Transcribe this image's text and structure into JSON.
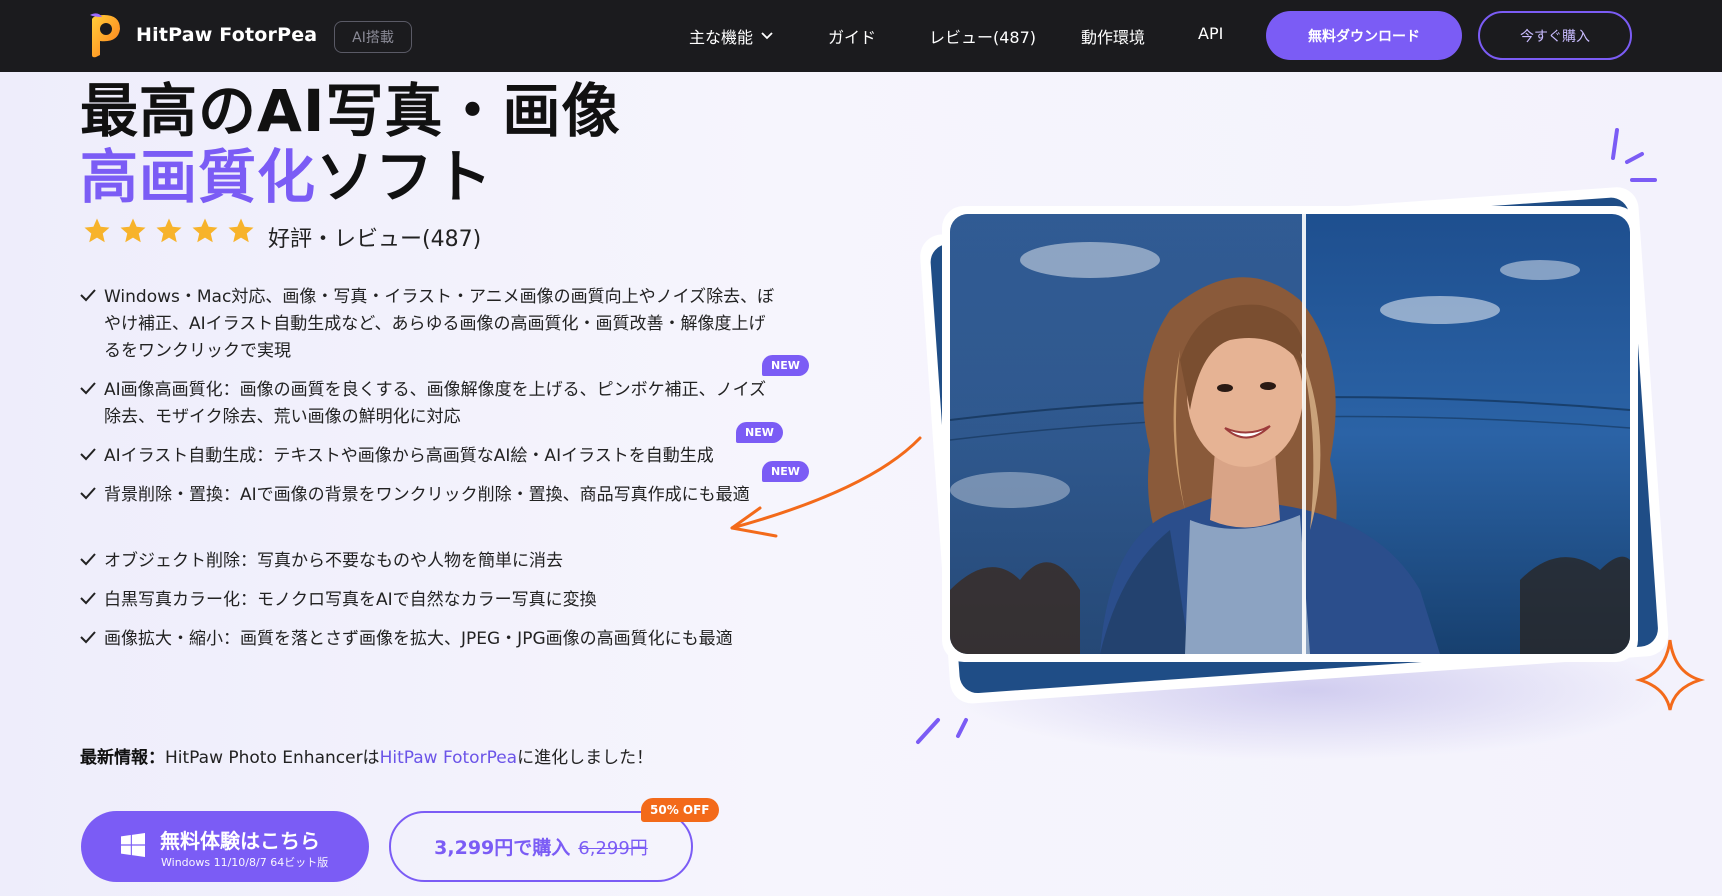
{
  "nav": {
    "logo_text": "HitPaw FotorPea",
    "ai_badge": "AI搭載",
    "items": [
      {
        "label": "主な機能"
      },
      {
        "label": "ガイド"
      },
      {
        "label": "レビュー(487)"
      },
      {
        "label": "動作環境"
      },
      {
        "label": "API"
      }
    ],
    "download_label": "無料ダウンロード",
    "buy_label": "今すぐ購入"
  },
  "hero": {
    "title_line1": "最高のAI写真・画像",
    "title_accent": "高画質化",
    "title_rest": "ソフト",
    "rating_stars": 5,
    "rating_text": "好評・レビュー(487)",
    "features": [
      {
        "text": "Windows・Mac対応、画像・写真・イラスト・アニメ画像の画質向上やノイズ除去、ぼやけ補正、AIイラスト自動生成など、あらゆる画像の高画質化・画質改善・解像度上げるをワンクリックで実現",
        "new": false
      },
      {
        "text": "AI画像高画質化：画像の画質を良くする、画像解像度を上げる、ピンボケ補正、ノイズ除去、モザイク除去、荒い画像の鮮明化に対応",
        "new": true
      },
      {
        "text": "AIイラスト自動生成：テキストや画像から高画質なAI絵・AIイラストを自動生成",
        "new": true
      },
      {
        "text": "背景削除・置換：AIで画像の背景をワンクリック削除・置換、商品写真作成にも最適",
        "new": true
      },
      {
        "text": "オブジェクト削除：写真から不要なものや人物を簡単に消去",
        "new": false
      },
      {
        "text": "白黒写真カラー化：モノクロ写真をAIで自然なカラー写真に変換",
        "new": false
      },
      {
        "text": "画像拡大・縮小：画質を落とさず画像を拡大、JPEG・JPG画像の高画質化にも最適",
        "new": false
      }
    ],
    "new_label": "NEW",
    "latest_prefix": "最新情報：",
    "latest_mid": "HitPaw Photo Enhancerは",
    "latest_link": "HitPaw FotorPea",
    "latest_suffix": "に進化しました！",
    "trial_title": "無料体験はこちら",
    "trial_sub": "Windows 11/10/8/7 64ビット版",
    "buy_price": "3,299円で購入",
    "buy_old_price": "6,299円",
    "off_badge": "50% OFF"
  },
  "colors": {
    "accent": "#7b5cf5",
    "nav_bg": "#1b1b1e",
    "orange": "#f36a1a",
    "star": "#f7b32b"
  }
}
